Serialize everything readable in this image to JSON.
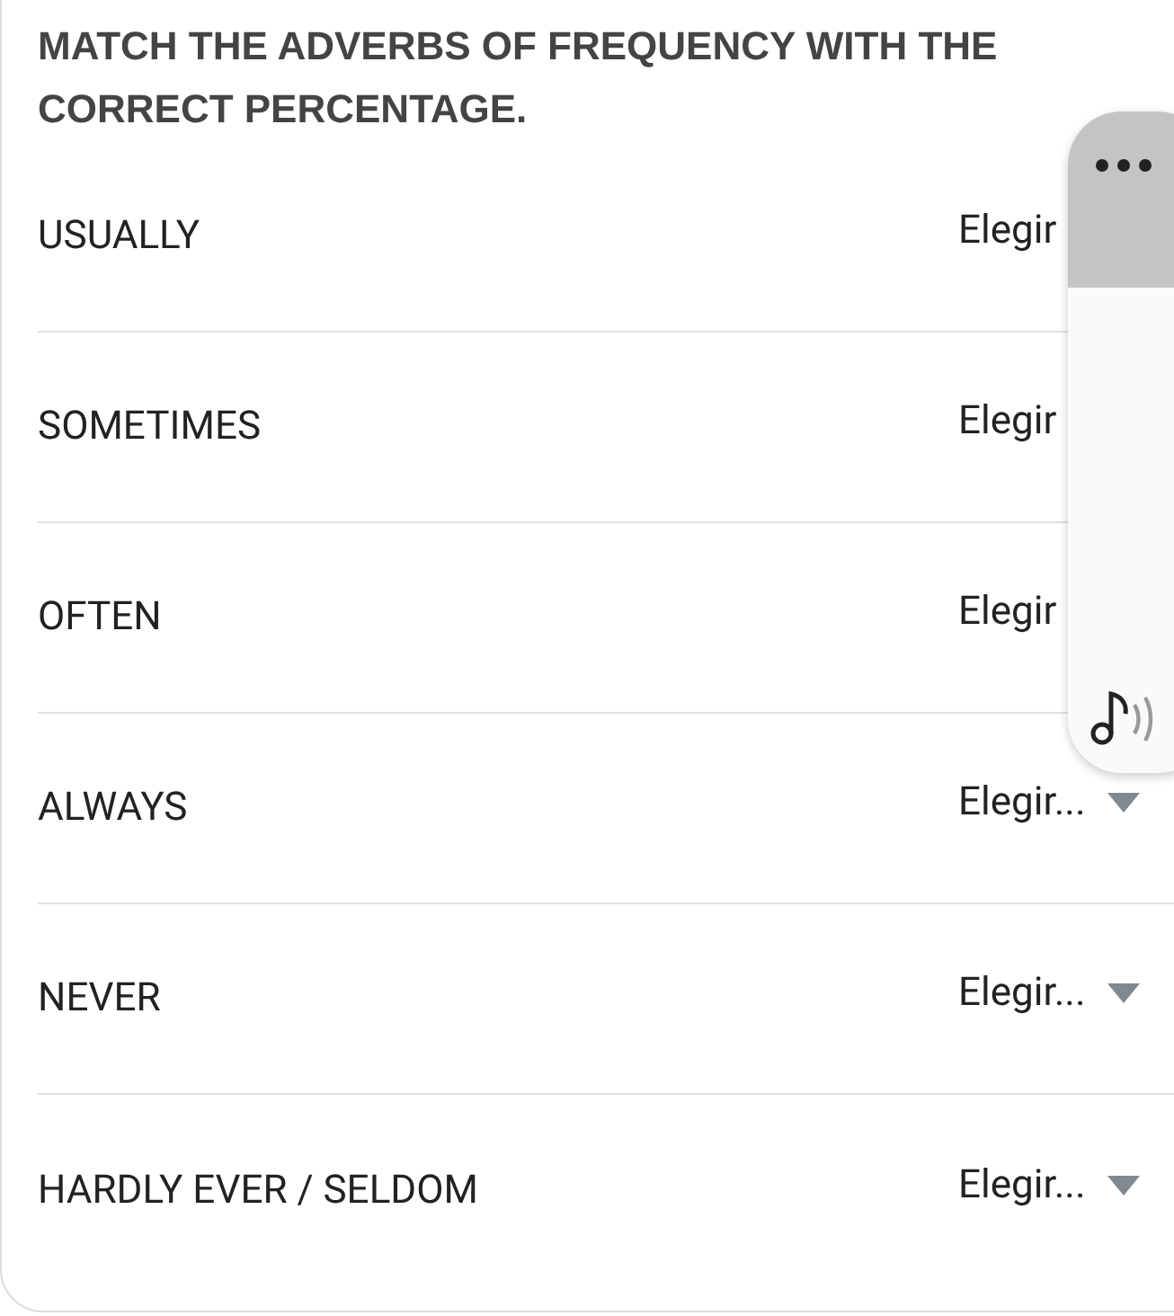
{
  "heading": "MATCH THE ADVERBS OF FREQUENCY WITH THE CORRECT PERCENTAGE.",
  "rows": [
    {
      "label": "USUALLY",
      "value": "Elegir",
      "kind": "partial"
    },
    {
      "label": "SOMETIMES",
      "value": "Elegir",
      "kind": "partial"
    },
    {
      "label": "OFTEN",
      "value": "Elegir",
      "kind": "partial"
    },
    {
      "label": "ALWAYS",
      "value": "Elegir...",
      "kind": "select"
    },
    {
      "label": "NEVER",
      "value": "Elegir...",
      "kind": "select"
    },
    {
      "label": "HARDLY EVER / SELDOM",
      "value": "Elegir...",
      "kind": "select"
    }
  ]
}
